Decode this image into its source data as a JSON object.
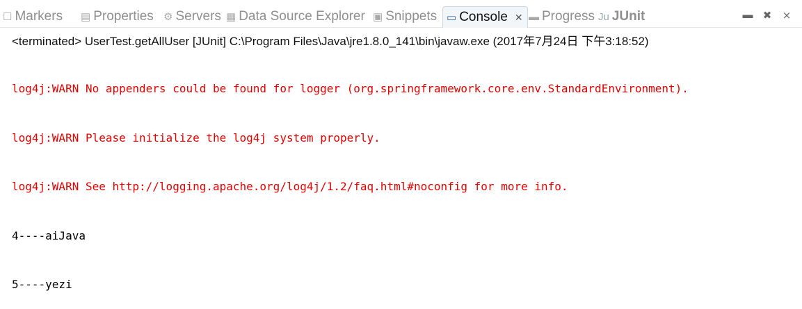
{
  "tabs": [
    {
      "icon": "markers-icon",
      "glyph": "☐",
      "label": "Markers"
    },
    {
      "icon": "properties-icon",
      "glyph": "▤",
      "label": "Properties"
    },
    {
      "icon": "servers-icon",
      "glyph": "⚙",
      "label": "Servers"
    },
    {
      "icon": "data-source-explorer-icon",
      "glyph": "▦",
      "label": "Data Source Explorer"
    },
    {
      "icon": "snippets-icon",
      "glyph": "▣",
      "label": "Snippets"
    },
    {
      "icon": "console-icon",
      "glyph": "▭",
      "label": "Console",
      "close": "✕"
    },
    {
      "icon": "progress-icon",
      "glyph": "▬",
      "label": "Progress"
    },
    {
      "icon": "junit-icon",
      "glyph": "Ju",
      "label": "JUnit"
    }
  ],
  "view_tools": [
    {
      "icon": "minimize-icon",
      "glyph": "▬"
    },
    {
      "icon": "remove-launch-icon",
      "glyph": "✖"
    },
    {
      "icon": "remove-all-terminated-icon",
      "glyph": "⨯"
    }
  ],
  "console": {
    "status": "<terminated> UserTest.getAllUser [JUnit] C:\\Program Files\\Java\\jre1.8.0_141\\bin\\javaw.exe (2017年7月24日 下午3:18:52)",
    "lines": [
      {
        "type": "warn",
        "text": "log4j:WARN No appenders could be found for logger (org.springframework.core.env.StandardEnvironment)."
      },
      {
        "type": "warn",
        "text": "log4j:WARN Please initialize the log4j system properly."
      },
      {
        "type": "warn",
        "text": "log4j:WARN See http://logging.apache.org/log4j/1.2/faq.html#noconfig for more info."
      },
      {
        "type": "out",
        "text": "4----aiJava"
      },
      {
        "type": "out",
        "text": "5----yezi"
      }
    ]
  },
  "colors": {
    "warn": "#e00000",
    "output": "#000000",
    "active_tab_bg": "#f3f6f9"
  }
}
